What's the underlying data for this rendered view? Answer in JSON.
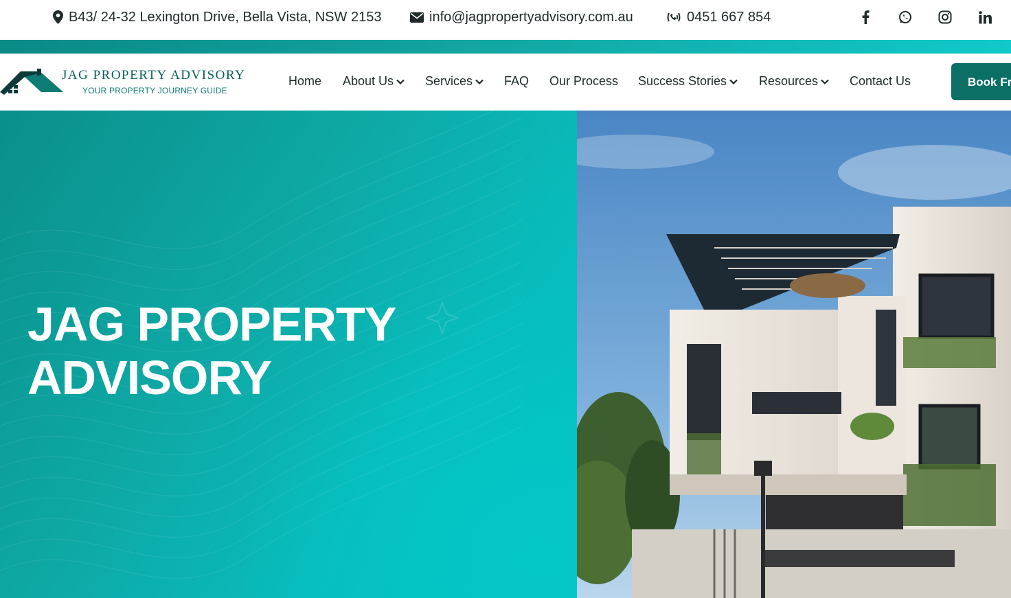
{
  "topbar": {
    "address": "B43/ 24-32 Lexington Drive, Bella Vista, NSW 2153",
    "email": "info@jagpropertyadvisory.com.au",
    "phone": "0451 667 854",
    "social": [
      {
        "name": "facebook-icon"
      },
      {
        "name": "whatsapp-icon"
      },
      {
        "name": "instagram-icon"
      },
      {
        "name": "linkedin-icon"
      }
    ]
  },
  "brand": {
    "title": "JAG PROPERTY ADVISORY",
    "tagline": "YOUR PROPERTY JOURNEY GUIDE",
    "accent": "#0b6f66",
    "teal": "#0ea8a5"
  },
  "nav": {
    "items": [
      {
        "label": "Home",
        "dropdown": false
      },
      {
        "label": "About Us",
        "dropdown": true
      },
      {
        "label": "Services",
        "dropdown": true
      },
      {
        "label": "FAQ",
        "dropdown": false
      },
      {
        "label": "Our Process",
        "dropdown": false
      },
      {
        "label": "Success Stories",
        "dropdown": true
      },
      {
        "label": "Resources",
        "dropdown": true
      },
      {
        "label": "Contact Us",
        "dropdown": false
      }
    ],
    "cta_label": "Book Fre"
  },
  "hero": {
    "title_line1": "JAG PROPERTY",
    "title_line2": "ADVISORY"
  }
}
